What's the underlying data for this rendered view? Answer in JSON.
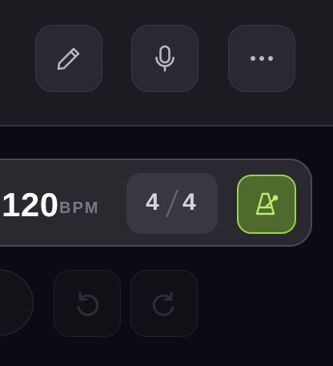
{
  "toolbar": {
    "buttons": [
      {
        "id": "edit",
        "icon": "pencil-icon"
      },
      {
        "id": "mic",
        "icon": "microphone-icon"
      },
      {
        "id": "more",
        "icon": "more-horizontal-icon"
      }
    ]
  },
  "tempo": {
    "bpm": "120",
    "unit": "BPM",
    "time_signature": {
      "top": "4",
      "bottom": "4"
    },
    "metronome": {
      "icon": "metronome-icon",
      "active": true
    }
  },
  "history": {
    "undo_icon": "undo-icon",
    "redo_icon": "redo-icon"
  },
  "colors": {
    "accent": "#9bd34f",
    "accent_bg": "#4f6a2c",
    "surface": "#2b2930",
    "background": "#0c0a12"
  }
}
